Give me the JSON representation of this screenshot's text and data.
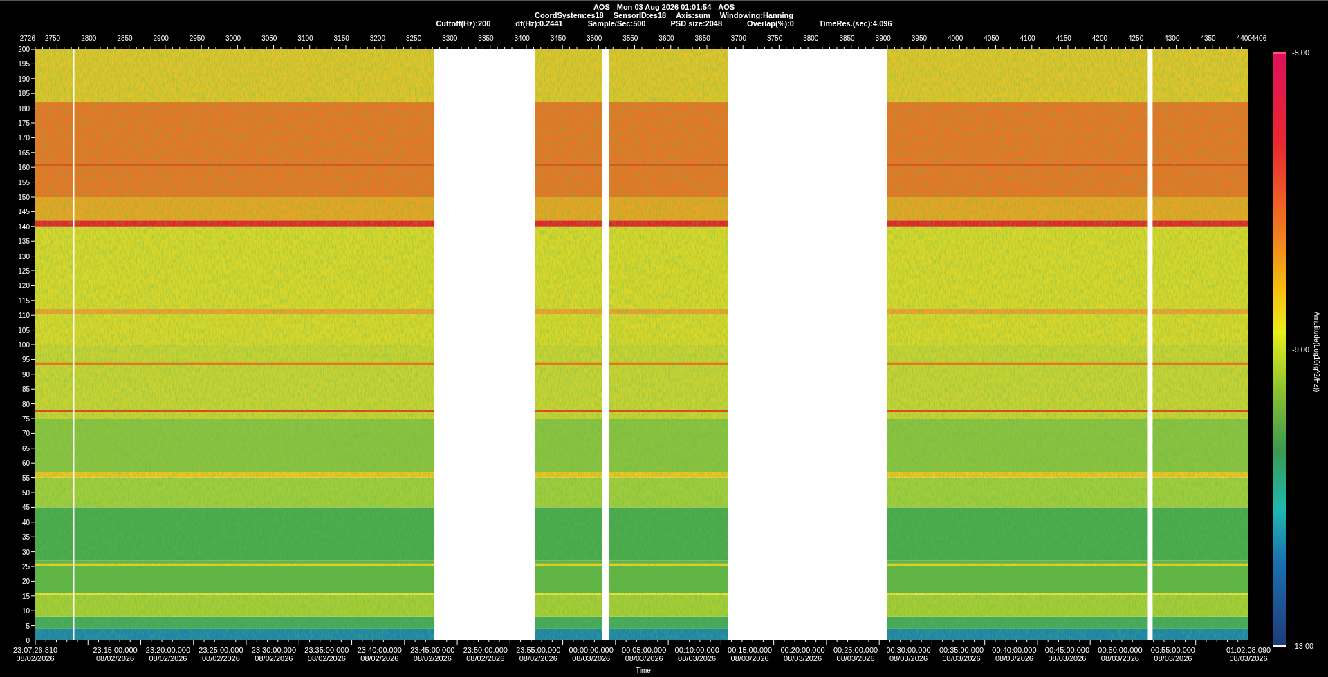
{
  "header": {
    "title_items": [
      "AOS",
      "Mon 03 Aug 2026 01:01:54",
      "AOS"
    ],
    "info_line_1": [
      "CoordSystem:es18",
      "SensorID:es18",
      "Axis:sum",
      "Windowing:Hanning"
    ],
    "info_line_2": [
      "Cuttoff(Hz):200",
      "df(Hz):0.2441",
      "Sample/Sec:500",
      "PSD size:2048",
      "Overlap(%):0",
      "TimeRes.(sec):4.096"
    ]
  },
  "top_axis": {
    "labels": [
      "2726",
      "2750",
      "2800",
      "2850",
      "2900",
      "2950",
      "3000",
      "3050",
      "3100",
      "3150",
      "3200",
      "3250",
      "3300",
      "3350",
      "3400",
      "3450",
      "3500",
      "3550",
      "3600",
      "3650",
      "3700",
      "3750",
      "3800",
      "3850",
      "3900",
      "3950",
      "4000",
      "4050",
      "4100",
      "4150",
      "4200",
      "4250",
      "4300",
      "4350",
      "4400",
      "4406"
    ]
  },
  "y_axis": {
    "labels": [
      "200",
      "195",
      "190",
      "185",
      "180",
      "175",
      "170",
      "165",
      "160",
      "155",
      "150",
      "145",
      "140",
      "135",
      "130",
      "125",
      "120",
      "115",
      "110",
      "105",
      "100",
      "95",
      "90",
      "85",
      "80",
      "75",
      "70",
      "65",
      "60",
      "55",
      "50",
      "45",
      "40",
      "35",
      "30",
      "25",
      "20",
      "15",
      "10",
      "5",
      "0"
    ]
  },
  "x_axis": {
    "title": "Time",
    "labels": [
      {
        "time": "23:07:26.810",
        "date": "08/02/2026"
      },
      {
        "time": "23:15:00.000",
        "date": "08/02/2026"
      },
      {
        "time": "23:20:00.000",
        "date": "08/02/2026"
      },
      {
        "time": "23:25:00.000",
        "date": "08/02/2026"
      },
      {
        "time": "23:30:00.000",
        "date": "08/02/2026"
      },
      {
        "time": "23:35:00.000",
        "date": "08/02/2026"
      },
      {
        "time": "23:40:00.000",
        "date": "08/02/2026"
      },
      {
        "time": "23:45:00.000",
        "date": "08/02/2026"
      },
      {
        "time": "23:50:00.000",
        "date": "08/02/2026"
      },
      {
        "time": "23:55:00.000",
        "date": "08/02/2026"
      },
      {
        "time": "00:00:00.000",
        "date": "08/03/2026"
      },
      {
        "time": "00:05:00.000",
        "date": "08/03/2026"
      },
      {
        "time": "00:10:00.000",
        "date": "08/03/2026"
      },
      {
        "time": "00:15:00.000",
        "date": "08/03/2026"
      },
      {
        "time": "00:20:00.000",
        "date": "08/03/2026"
      },
      {
        "time": "00:25:00.000",
        "date": "08/03/2026"
      },
      {
        "time": "00:30:00.000",
        "date": "08/03/2026"
      },
      {
        "time": "00:35:00.000",
        "date": "08/03/2026"
      },
      {
        "time": "00:40:00.000",
        "date": "08/03/2026"
      },
      {
        "time": "00:45:00.000",
        "date": "08/03/2026"
      },
      {
        "time": "00:50:00.000",
        "date": "08/03/2026"
      },
      {
        "time": "00:55:00.000",
        "date": "08/03/2026"
      },
      {
        "time": "01:02:08.090",
        "date": "08/03/2026"
      }
    ]
  },
  "colorbar": {
    "title": "Amplitude(Log10(g^2/Hz))",
    "labels": [
      "-5.00",
      "-9.00",
      "-13.00"
    ]
  }
}
